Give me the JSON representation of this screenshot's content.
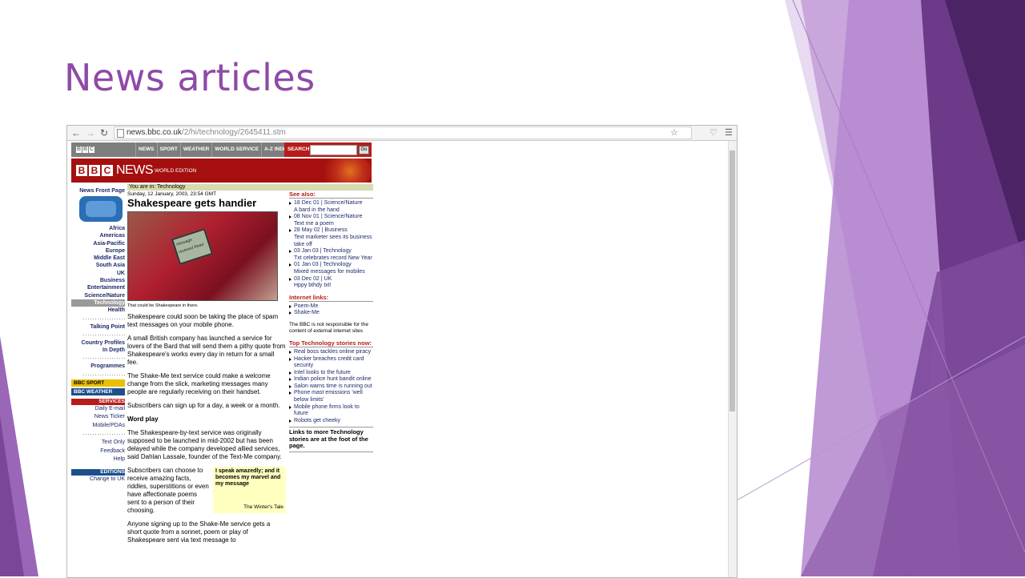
{
  "slide": {
    "title": "News articles"
  },
  "colors": {
    "accent": "#8e4aa6",
    "bbc_red": "#a50f0f",
    "nav_blue": "#1d2a6b"
  },
  "browser": {
    "url_host": "news.bbc.co.uk",
    "url_path": "/2/hi/technology/2645411.stm",
    "icons": [
      "back-icon",
      "forward-icon",
      "reload-icon",
      "page-icon",
      "bookmark-star-icon",
      "extension-icon",
      "menu-icon"
    ]
  },
  "bbc": {
    "topnav": [
      "NEWS",
      "SPORT",
      "WEATHER",
      "WORLD SERVICE",
      "A-Z INDEX"
    ],
    "search_label": "SEARCH",
    "go_label": "Go",
    "logo_letters": [
      "B",
      "B",
      "C"
    ],
    "banner_news": "NEWS",
    "banner_edition": "WORLD EDITION",
    "you_are_in": "You are in: Technology",
    "leftnav": {
      "front": "News Front Page",
      "regions": [
        "Africa",
        "Americas",
        "Asia-Pacific",
        "Europe",
        "Middle East",
        "South Asia",
        "UK",
        "Business",
        "Entertainment",
        "Science/Nature",
        "Technology",
        "Health"
      ],
      "selected": "Technology",
      "extra": [
        "Talking Point"
      ],
      "extra2": [
        "Country Profiles",
        "In Depth"
      ],
      "extra3": [
        "Programmes"
      ],
      "sport_badge": "BBC SPORT",
      "weather_badge": "BBC WEATHER",
      "services_head": "SERVICES",
      "services": [
        "Daily E-mail",
        "News Ticker",
        "Mobile/PDAs"
      ],
      "services2": [
        "Text Only",
        "Feedback",
        "Help"
      ],
      "editions_head": "EDITIONS",
      "editions": [
        "Change to UK"
      ]
    },
    "article": {
      "date": "Sunday, 12 January, 2003, 23:54 GMT",
      "headline": "Shakespeare gets handier",
      "photo_screen_text": "message received Read",
      "caption": "That could be Shakespeare in there.",
      "p1": "Shakespeare could soon be taking the place of spam text messages on your mobile phone.",
      "p2": "A small British company has launched a service for lovers of the Bard that will send them a pithy quote from Shakespeare's works every day in return for a small fee.",
      "p3": "The Shake-Me text service could make a welcome change from the slick, marketing messages many people are regularly receiving on their handset.",
      "p4": "Subscribers can sign up for a day, a week or a month.",
      "subhead": "Word play",
      "p5": "The Shakespeare-by-text service was originally supposed to be launched in mid-2002 but has been delayed while the company developed allied services, said Dahlan Lassale, founder of the Text-Me company.",
      "p6": "Subscribers can choose to receive amazing facts, riddles, superstitions or even have affectionate poems sent to a person of their choosing.",
      "quote": "I speak amazedly; and it becomes my marvel and my message",
      "quote_src": "The Winter's Tale",
      "p7": "Anyone signing up to the Shake-Me service gets a short quote from a sonnet, poem or play of Shakespeare sent via text message to"
    },
    "see_also": {
      "head": "See also:",
      "items": [
        {
          "meta": "18 Dec 01 | Science/Nature",
          "title": "A bard in the hand"
        },
        {
          "meta": "08 Nov 01 | Science/Nature",
          "title": "Text me a poem"
        },
        {
          "meta": "28 May 02 | Business",
          "title": "Text marketer sees its business take off"
        },
        {
          "meta": "03 Jan 03 | Technology",
          "title": "Txt celebrates record New Year"
        },
        {
          "meta": "01 Jan 03 | Technology",
          "title": "Mixed messages for mobiles"
        },
        {
          "meta": "03 Dec 02 | UK",
          "title": "Hppy bthdy txt!"
        }
      ]
    },
    "internet_links": {
      "head": "Internet links:",
      "items": [
        "Poem-Me",
        "Shake-Me"
      ]
    },
    "disclaimer": "The BBC is not responsible for the content of external internet sites",
    "top_stories": {
      "head": "Top Technology stories now:",
      "items": [
        "Real boss tackles online piracy",
        "Hacker breaches credit card security",
        "Intel looks to the future",
        "Indian police hunt bandit online",
        "Salon warns time is running out",
        "Phone mast emissions 'well below limits'",
        "Mobile phone firms look to future",
        "Robots get cheeky"
      ]
    },
    "more_links": "Links to more Technology stories are at the foot of the page."
  }
}
